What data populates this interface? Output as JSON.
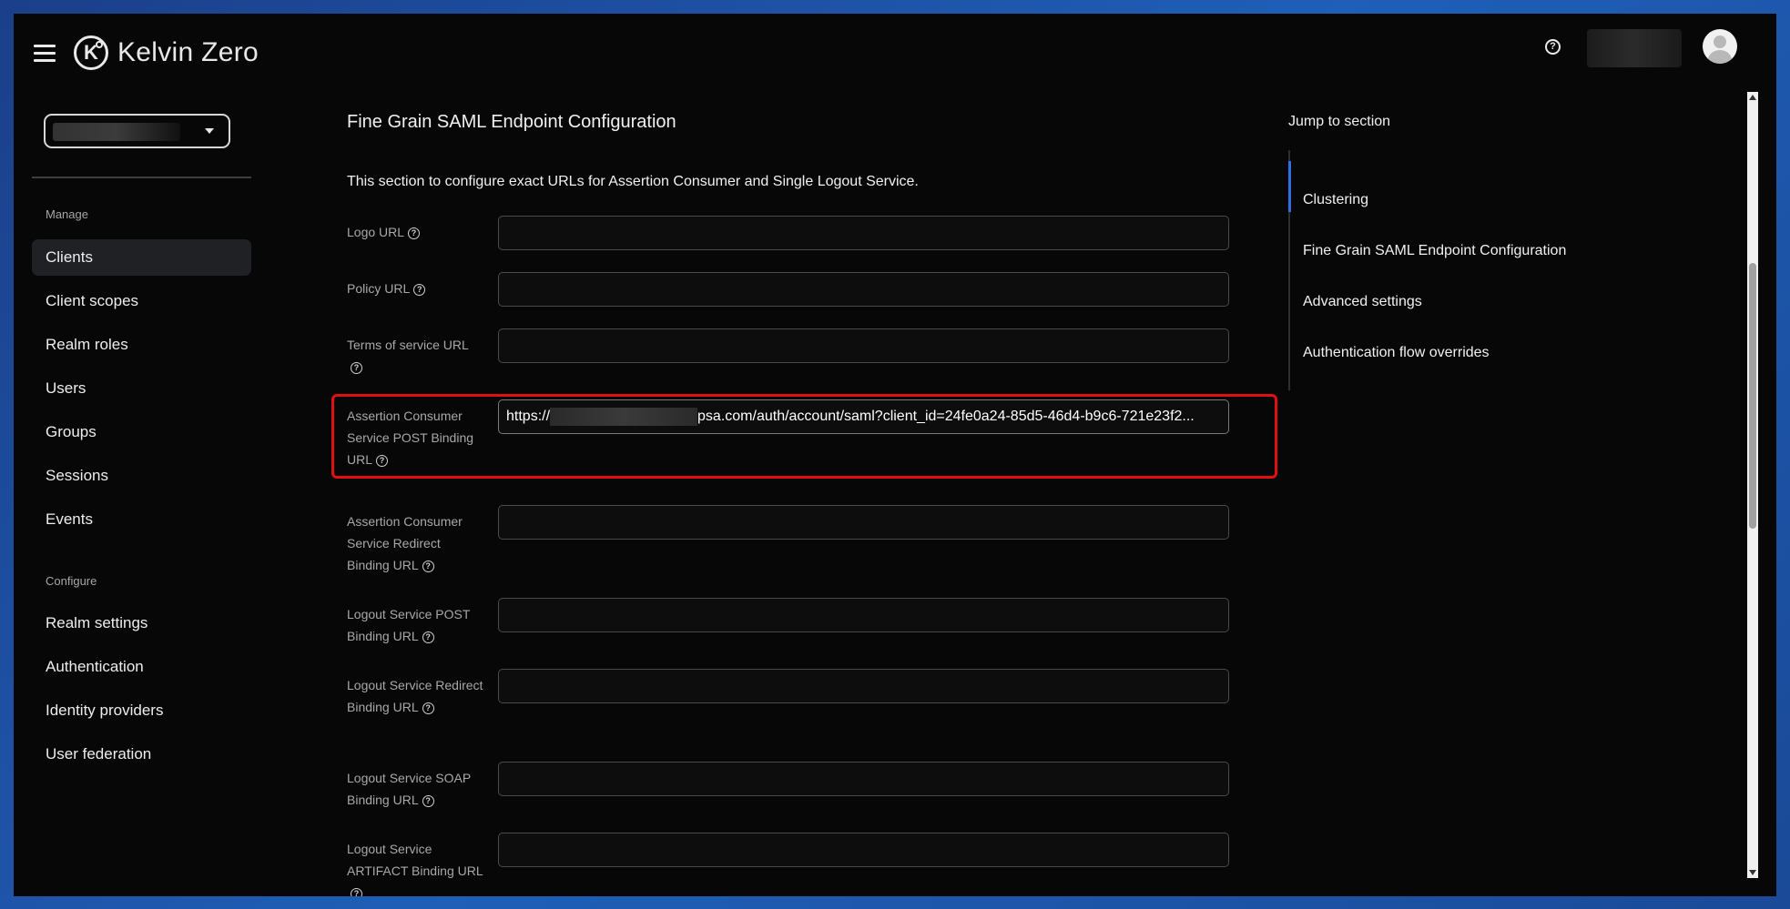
{
  "header": {
    "app_name": "Kelvin Zero",
    "menu_icon": "hamburger-menu-icon",
    "help_icon": "question-circle-icon",
    "avatar_icon": "user-avatar-icon"
  },
  "sidebar": {
    "realm_selector_caret": "caret-down-icon",
    "groups": [
      {
        "label": "Manage",
        "items": [
          "Clients",
          "Client scopes",
          "Realm roles",
          "Users",
          "Groups",
          "Sessions",
          "Events"
        ]
      },
      {
        "label": "Configure",
        "items": [
          "Realm settings",
          "Authentication",
          "Identity providers",
          "User federation"
        ]
      }
    ],
    "active_item": "Clients"
  },
  "main": {
    "section_title": "Fine Grain SAML Endpoint Configuration",
    "section_description": "This section to configure exact URLs for Assertion Consumer and Single Logout Service.",
    "fields": [
      {
        "label": "Logo URL",
        "value": ""
      },
      {
        "label": "Policy URL",
        "value": ""
      },
      {
        "label": "Terms of service URL",
        "value": ""
      },
      {
        "label": "Assertion Consumer Service POST Binding URL",
        "value_prefix": "https://",
        "value_suffix": "psa.com/auth/account/saml?client_id=24fe0a24-85d5-46d4-b9c6-721e23f2..."
      },
      {
        "label": "Assertion Consumer Service Redirect Binding URL",
        "value": ""
      },
      {
        "label": "Logout Service POST Binding URL",
        "value": ""
      },
      {
        "label": "Logout Service Redirect Binding URL",
        "value": ""
      },
      {
        "label": "Logout Service SOAP Binding URL",
        "value": ""
      },
      {
        "label": "Logout Service ARTIFACT Binding URL",
        "value": ""
      }
    ],
    "help_glyph": "?"
  },
  "jump": {
    "title": "Jump to section",
    "items": [
      "Clustering",
      "Fine Grain SAML Endpoint Configuration",
      "Advanced settings",
      "Authentication flow overrides"
    ],
    "active_item": "Clustering"
  },
  "colors": {
    "background": "#070707",
    "accent_active": "#2f6fe0",
    "highlight_border": "#e01010"
  }
}
